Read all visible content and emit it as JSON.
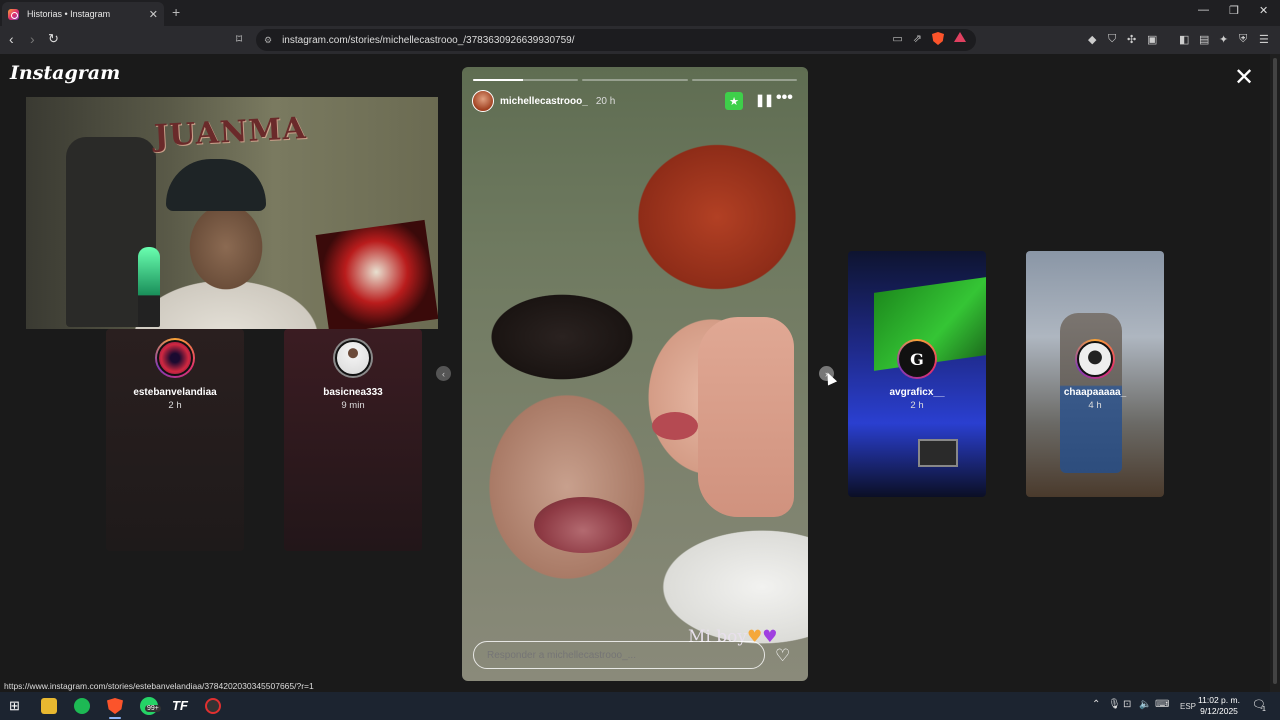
{
  "browser": {
    "tab_title": "Historias • Instagram",
    "url": "instagram.com/stories/michellecastrooo_/3783630926639930759/",
    "status_url": "https://www.instagram.com/stories/estebanvelandiaa/3784202030345507665/?r=1"
  },
  "page": {
    "logo": "Instagram"
  },
  "webcam": {
    "sign_text": "JUANMA"
  },
  "previews": {
    "left": [
      {
        "username": "estebanvelandiaa",
        "time": "2 h",
        "avatar_color": "#d02840"
      },
      {
        "username": "basicnea333",
        "time": "9 min",
        "avatar_color": "#d8d8d8"
      }
    ],
    "right": [
      {
        "username": "avgraficx__",
        "time": "2 h",
        "avatar_color": "#111111"
      },
      {
        "username": "chaapaaaaa_",
        "time": "4 h",
        "avatar_color": "#eeeeee"
      }
    ]
  },
  "story": {
    "username": "michellecastrooo_",
    "time": "20 h",
    "caption": "Mi boy",
    "reply_placeholder": "Responder a michellecastrooo_...",
    "progress": [
      0.47,
      0,
      0
    ]
  },
  "taskbar": {
    "whatsapp_badge": "99+",
    "language": "ESP",
    "time": "11:02 p. m.",
    "date": "9/12/2025",
    "notification_count": "1"
  },
  "colors": {
    "accent_star": "#3ecf4a",
    "brave": "#fb542b",
    "page_bg": "#1a1a1a"
  }
}
